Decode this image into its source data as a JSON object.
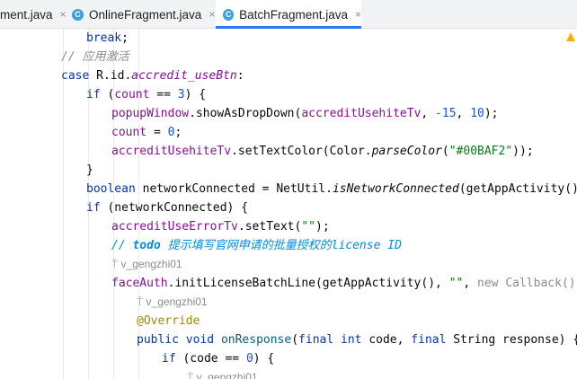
{
  "tabs": [
    {
      "label": "ment.java",
      "icon": "java-file-icon",
      "active": false
    },
    {
      "label": "OnlineFragment.java",
      "icon": "java-class-icon",
      "active": false
    },
    {
      "label": "BatchFragment.java",
      "icon": "java-class-icon",
      "active": true
    }
  ],
  "tab_close_glyph": "×",
  "class_icon_letter": "C",
  "inlay_author": "v_gengzhi01",
  "code": {
    "l1": {
      "t1": "break",
      "t2": ";"
    },
    "l2": {
      "t1": "// 应用激活"
    },
    "l3": {
      "t1": "case ",
      "t2": "R",
      "t3": ".",
      "t4": "id",
      "t5": ".",
      "t6": "accredit_useBtn",
      "t7": ":"
    },
    "l4": {
      "t1": "if ",
      "t2": "(",
      "t3": "count",
      "t4": " == ",
      "t5": "3",
      "t6": ") {"
    },
    "l5": {
      "t1": "popupWindow",
      "t2": ".showAsDropDown(",
      "t3": "accreditUsehiteTv",
      "t4": ", ",
      "t5": "-15",
      "t6": ", ",
      "t7": "10",
      "t8": ");"
    },
    "l6": {
      "t1": "count",
      "t2": " = ",
      "t3": "0",
      "t4": ";"
    },
    "l7": {
      "t1": "accreditUsehiteTv",
      "t2": ".setTextColor(Color.",
      "t3": "parseColor",
      "t4": "(",
      "t5": "\"#00BAF2\"",
      "t6": "));"
    },
    "l8": {
      "t1": "}"
    },
    "l9": {
      "t1": "boolean ",
      "t2": "networkConnected = NetUtil.",
      "t3": "isNetworkConnected",
      "t4": "(getAppActivity());"
    },
    "l10": {
      "t1": "if ",
      "t2": "(networkConnected) {"
    },
    "l11": {
      "t1": "accreditUseErrorTv",
      "t2": ".setText(",
      "t3": "\"\"",
      "t4": ");"
    },
    "l12": {
      "t1": "// ",
      "t2": "todo",
      "t3": " 提示填写官网申请的批量授权的license ID"
    },
    "l14": {
      "t1": "faceAuth",
      "t2": ".initLicenseBatchLine(getAppActivity(), ",
      "t3": "\"\"",
      "t4": ", ",
      "t5": "new ",
      "t6": "Callback() {"
    },
    "l16": {
      "t1": "@Override"
    },
    "l17": {
      "t1": "public ",
      "t2": "void ",
      "t3": "onResponse",
      "t4": "(",
      "t5": "final ",
      "t6": "int ",
      "t7": "code, ",
      "t8": "final ",
      "t9": "String response) {"
    },
    "l18": {
      "t1": "if ",
      "t2": "(code == ",
      "t3": "0",
      "t4": ") {"
    }
  }
}
